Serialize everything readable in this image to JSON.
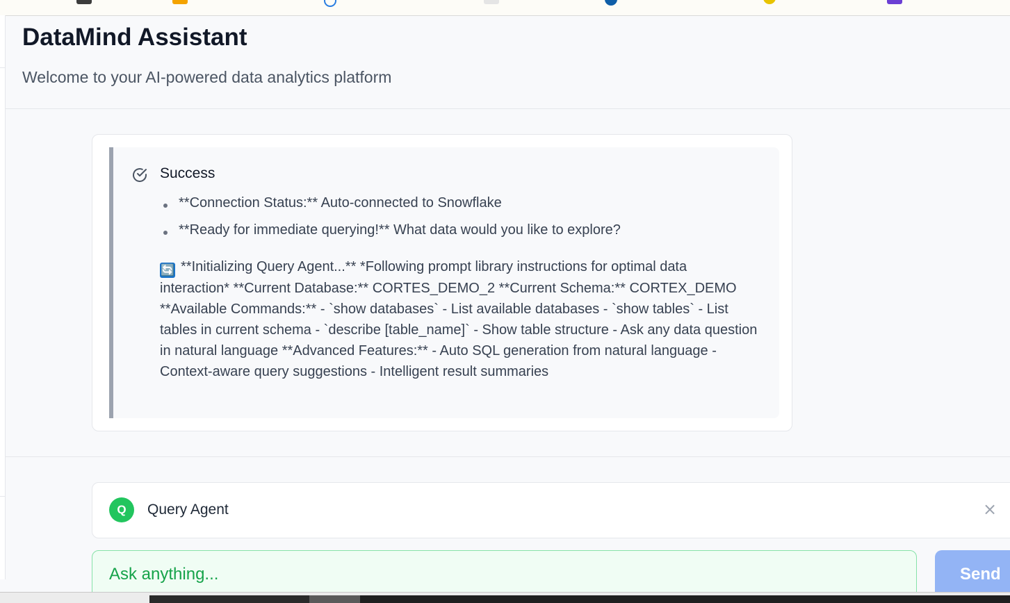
{
  "header": {
    "title": "DataMind Assistant",
    "subtitle": "Welcome to your AI-powered data analytics platform"
  },
  "message": {
    "status_title": "Success",
    "bullets": [
      "**Connection Status:** Auto-connected to Snowflake",
      "**Ready for immediate querying!** What data would you like to explore?"
    ],
    "refresh_glyph": "🔄",
    "body": "**Initializing Query Agent...** *Following prompt library instructions for optimal data interaction* **Current Database:** CORTES_DEMO_2 **Current Schema:** CORTEX_DEMO **Available Commands:** - `show databases` - List available databases - `show tables` - List tables in current schema - `describe [table_name]` - Show table structure - Ask any data question in natural language **Advanced Features:** - Auto SQL generation from natural language - Context-aware query suggestions - Intelligent result summaries"
  },
  "agent": {
    "avatar_letter": "Q",
    "name": "Query Agent",
    "close_glyph": "×"
  },
  "input": {
    "placeholder": "Ask anything...",
    "send_label": "Send"
  },
  "icons": {
    "status": "check-circle-icon",
    "refresh": "refresh-icon",
    "close": "close-icon"
  },
  "colors": {
    "agent_avatar": "#22c55e",
    "send_button": "#93b4f5",
    "input_text": "#16a34a",
    "alert_border": "#9ca3af"
  }
}
